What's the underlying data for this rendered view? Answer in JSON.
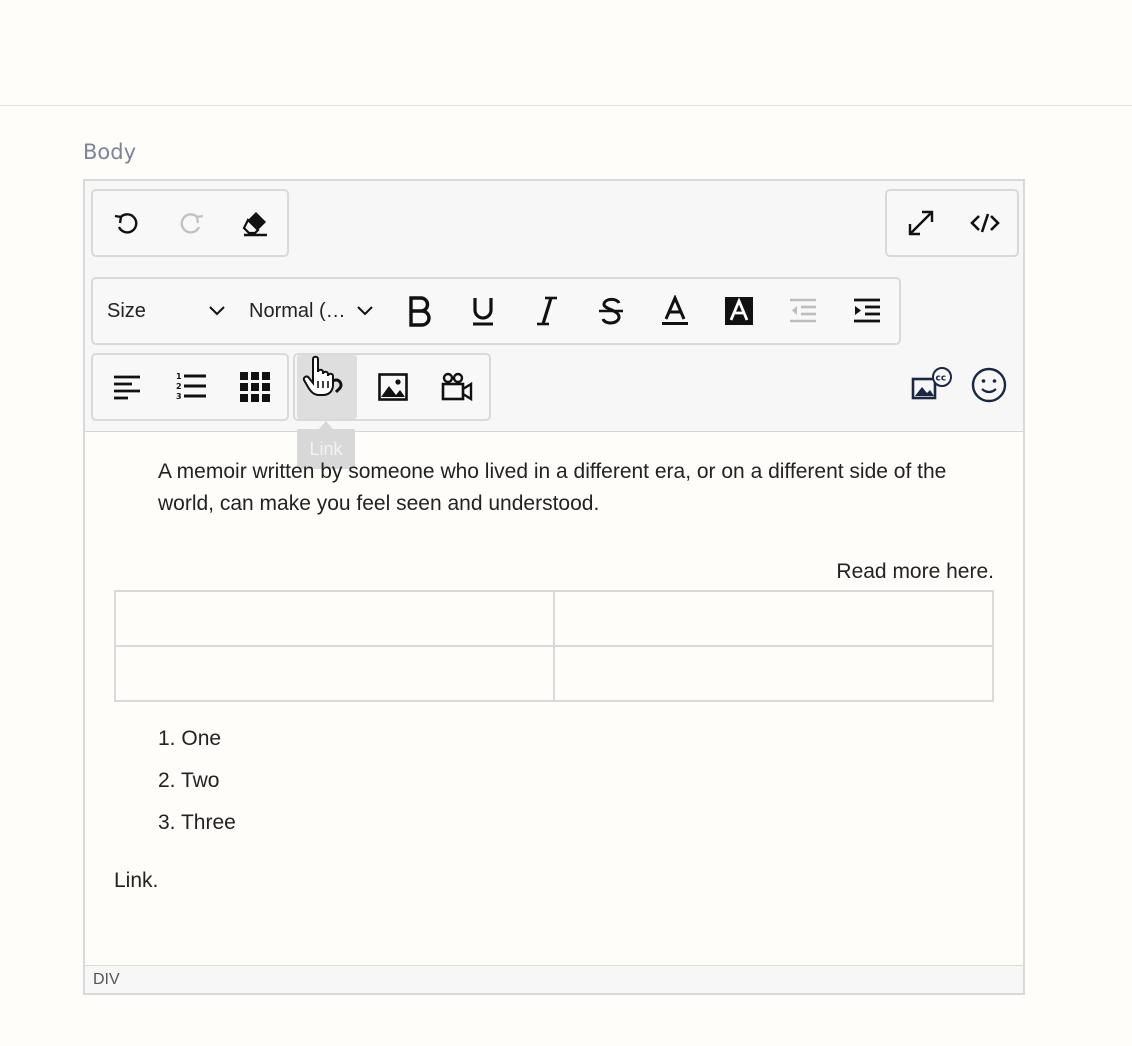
{
  "field": {
    "label": "Body"
  },
  "toolbar": {
    "history": [
      {
        "name": "undo-button",
        "icon": "undo-icon"
      },
      {
        "name": "redo-button",
        "icon": "redo-icon"
      },
      {
        "name": "clear-format-button",
        "icon": "eraser-icon"
      }
    ],
    "view": [
      {
        "name": "fullscreen-button",
        "icon": "expand-icon"
      },
      {
        "name": "source-code-button",
        "icon": "code-icon"
      }
    ],
    "size_dropdown": {
      "selected": "Size"
    },
    "format_dropdown": {
      "selected": "Normal (…"
    },
    "format_buttons": [
      {
        "name": "bold-button",
        "icon": "bold-icon"
      },
      {
        "name": "underline-button",
        "icon": "underline-icon"
      },
      {
        "name": "italic-button",
        "icon": "italic-icon"
      },
      {
        "name": "strikethrough-button",
        "icon": "strikethrough-icon"
      },
      {
        "name": "font-color-button",
        "icon": "font-color-icon"
      },
      {
        "name": "highlight-color-button",
        "icon": "highlight-icon"
      },
      {
        "name": "outdent-button",
        "icon": "outdent-icon"
      },
      {
        "name": "indent-button",
        "icon": "indent-icon"
      }
    ],
    "tooltip": "Link"
  },
  "content": {
    "blockquote": "A memoir written by someone who lived in a different era, or on a different side of the world, can make you feel seen and understood.",
    "read_more": "Read more here.",
    "list": [
      "One",
      "Two",
      "Three"
    ],
    "link_text": "Link."
  },
  "statusbar": {
    "path": "DIV"
  },
  "colors": {
    "accent": "#1a2744",
    "border": "#d9d9d9",
    "label": "#7b8499"
  }
}
